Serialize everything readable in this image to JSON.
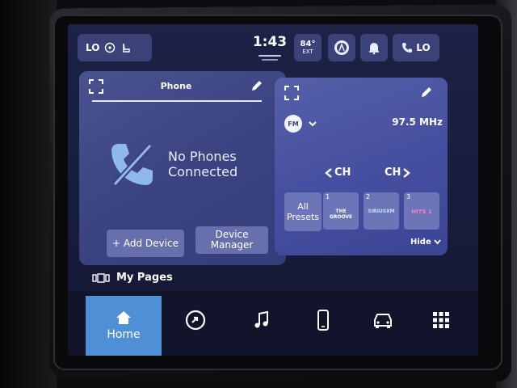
{
  "status_bar": {
    "climate_label": "LO",
    "clock": "1:43",
    "temp_value": "84°",
    "temp_label": "EXT",
    "call_label": "LO"
  },
  "phone_card": {
    "title": "Phone",
    "message_line1": "No Phones",
    "message_line2": "Connected",
    "add_device_label": "+ Add Device",
    "device_manager_line1": "Device",
    "device_manager_line2": "Manager"
  },
  "radio_card": {
    "band": "FM",
    "frequency": "97.5 MHz",
    "ch_prev_label": "CH",
    "ch_next_label": "CH",
    "all_presets_line1": "All",
    "all_presets_line2": "Presets",
    "presets": [
      {
        "number": "1",
        "logo": "THE GROOVE"
      },
      {
        "number": "2",
        "logo": "SIRIUSXM"
      },
      {
        "number": "3",
        "logo": "HITS 1"
      }
    ],
    "hide_label": "Hide"
  },
  "my_pages": {
    "label": "My Pages"
  },
  "nav": {
    "home_label": "Home",
    "items": [
      "apps-icon",
      "music-icon",
      "phone-icon",
      "vehicle-icon",
      "grid-icon"
    ]
  },
  "colors": {
    "screen_bg": "#1d2246",
    "card_bg": "#3a4280",
    "button_bg": "#6770ad",
    "nav_active": "#4f8fd6"
  }
}
